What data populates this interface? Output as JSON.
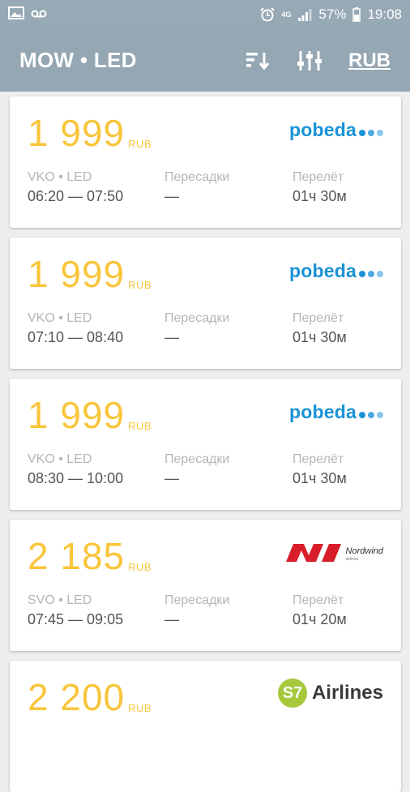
{
  "status_bar": {
    "network": "4G",
    "battery": "57%",
    "time": "19:08"
  },
  "app_bar": {
    "route": "MOW • LED",
    "currency": "RUB"
  },
  "labels": {
    "transfers": "Пересадки",
    "flight": "Перелёт"
  },
  "flights": [
    {
      "price": "1 999",
      "currency": "RUB",
      "airline": "pobeda",
      "route": "VKO • LED",
      "times": "06:20 — 07:50",
      "transfers": "—",
      "duration": "01ч 30м"
    },
    {
      "price": "1 999",
      "currency": "RUB",
      "airline": "pobeda",
      "route": "VKO • LED",
      "times": "07:10 — 08:40",
      "transfers": "—",
      "duration": "01ч 30м"
    },
    {
      "price": "1 999",
      "currency": "RUB",
      "airline": "pobeda",
      "route": "VKO • LED",
      "times": "08:30 — 10:00",
      "transfers": "—",
      "duration": "01ч 30м"
    },
    {
      "price": "2 185",
      "currency": "RUB",
      "airline": "Nordwind",
      "airline_sub": "airlines",
      "route": "SVO • LED",
      "times": "07:45 — 09:05",
      "transfers": "—",
      "duration": "01ч 20м"
    },
    {
      "price": "2 200",
      "currency": "RUB",
      "airline": "Airlines",
      "airline_mark": "S7"
    }
  ],
  "colors": {
    "price": "#f9c53b",
    "header": "#94a7b3",
    "pobeda_blue": "#1a93d6",
    "nordwind_red": "#d81e2a",
    "s7_green": "#a6c83b"
  }
}
